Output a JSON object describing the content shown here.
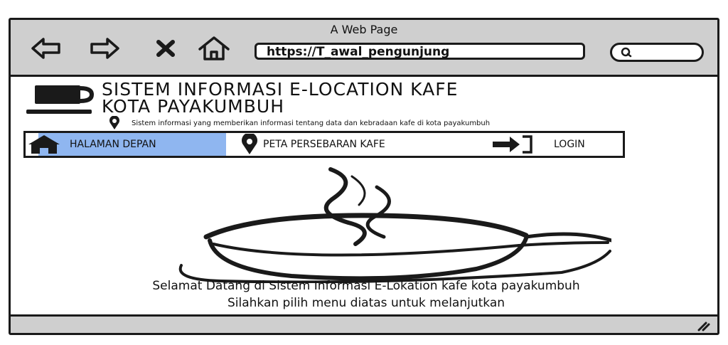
{
  "browser": {
    "title": "A Web Page",
    "url": "https://T_awal_pengunjung",
    "icons": [
      "back-arrow-icon",
      "forward-arrow-icon",
      "close-icon",
      "home-icon",
      "search-icon"
    ]
  },
  "header": {
    "title_line1": "SISTEM INFORMASI E-LOCATION KAFE",
    "title_line2": "KOTA PAYAKUMBUH",
    "subtitle": "Sistem informasi yang memberikan informasi tentang data dan kebradaan kafe di kota payakumbuh"
  },
  "menu": {
    "items": [
      {
        "label": "HALAMAN DEPAN",
        "icon": "home-icon",
        "active": true
      },
      {
        "label": "PETA PERSEBARAN KAFE",
        "icon": "map-pin-icon",
        "active": false
      },
      {
        "label": "LOGIN",
        "icon": "login-icon",
        "active": false
      }
    ]
  },
  "main": {
    "welcome_line1": "Selamat Datang di Sistem Informasi E-Lokation kafe kota payakumbuh",
    "welcome_line2": "Silahkan pilih menu diatas untuk melanjutkan"
  },
  "colors": {
    "chrome": "#cfcfcf",
    "active_menu": "#8fb6f0",
    "stroke": "#1a1a1a"
  }
}
